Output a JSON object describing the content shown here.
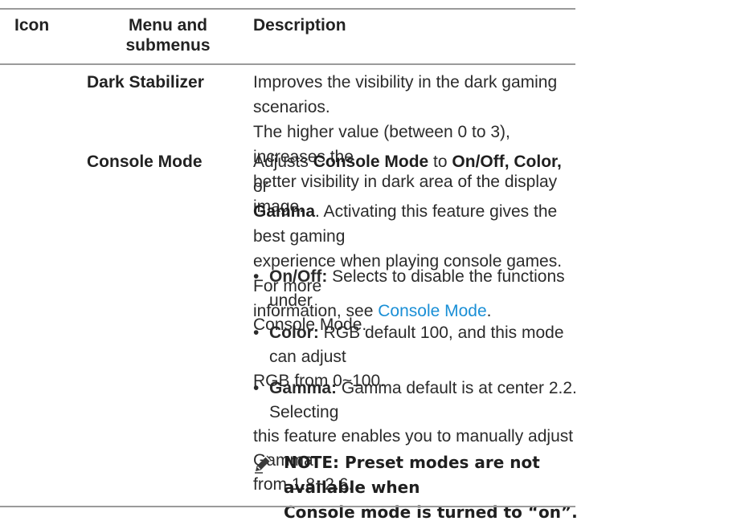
{
  "table": {
    "headers": {
      "icon": "Icon",
      "menu_line1": "Menu and",
      "menu_line2": "submenus",
      "description": "Description"
    },
    "rows": [
      {
        "menu": "Dark Stabilizer",
        "description_lines": [
          "Improves the visibility in the dark gaming scenarios.",
          "The higher value (between 0 to 3), increases the",
          "better visibility in dark area of the display image."
        ]
      },
      {
        "menu": "Console Mode",
        "description": {
          "l1_a": "Adjusts ",
          "l1_b": "Console Mode",
          "l1_c": " to ",
          "l1_d": "On/Off, Color,",
          "l1_e": " or",
          "l2_a": "Gamma",
          "l2_b": ". Activating this feature gives the best gaming",
          "l3": "experience when playing console games. For more",
          "l4_a": "information, see ",
          "l4_link": "Console Mode",
          "l4_c": "."
        },
        "bullets": [
          {
            "term": "On/Off:",
            "line1": " Selects to disable the functions under",
            "rest": [
              "Console Mode."
            ]
          },
          {
            "term": "Color:",
            "line1": " RGB default 100, and this mode can adjust",
            "rest": [
              "RGB from 0~100."
            ]
          },
          {
            "term": "Gamma:",
            "line1": " Gamma default is at center 2.2. Selecting",
            "rest": [
              "this feature enables you to manually adjust Gamma",
              "from 1.8~2.6."
            ]
          }
        ],
        "note": {
          "icon": "pencil-note-icon",
          "line1": "NOTE: Preset modes are not available when",
          "line2": "Console mode is turned to “on”."
        }
      }
    ]
  },
  "colors": {
    "link": "#1a8fd6",
    "rule": "#9a9a9a",
    "text": "#2b2b2b"
  }
}
